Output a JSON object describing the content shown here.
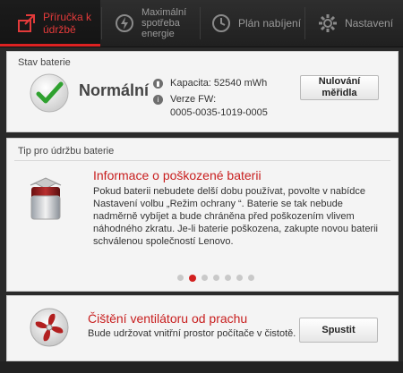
{
  "nav": {
    "tabs": [
      {
        "label_line1": "Příručka k",
        "label_line2": "údržbě",
        "icon": "maintenance-icon",
        "active": true
      },
      {
        "label_line1": "Maximální",
        "label_line2": "spotřeba",
        "label_line3": "energie",
        "icon": "power-icon",
        "active": false
      },
      {
        "label_line1": "Plán nabíjení",
        "icon": "clock-icon",
        "active": false
      },
      {
        "label_line1": "Nastavení",
        "icon": "gear-icon",
        "active": false
      }
    ]
  },
  "battery_status": {
    "title": "Stav baterie",
    "status": "Normální",
    "capacity_label": "Kapacita: 52540 mWh",
    "fw_label": "Verze FW:",
    "fw_value": "0005-0035-1019-0005",
    "reset_button_line1": "Nulování",
    "reset_button_line2": "měřidla"
  },
  "tip": {
    "section_title": "Tip pro údržbu baterie",
    "heading": "Informace o poškozené baterii",
    "body": "Pokud baterii nebudete delší dobu používat, povolte v nabídce Nastavení volbu „Režim ochrany “. Baterie se tak nebude nadměrně vybíjet a bude chráněna před poškozením vlivem náhodného zkratu. Je-li baterie poškozena, zakupte novou baterii schválenou společností Lenovo.",
    "pager_total": 7,
    "pager_current": 2
  },
  "fan": {
    "heading": "Čištění ventilátoru od prachu",
    "description": "Bude udržovat vnitřní prostor počítače v čistotě.",
    "button": "Spustit"
  },
  "colors": {
    "accent": "#d2201f",
    "check": "#2fa12f"
  }
}
